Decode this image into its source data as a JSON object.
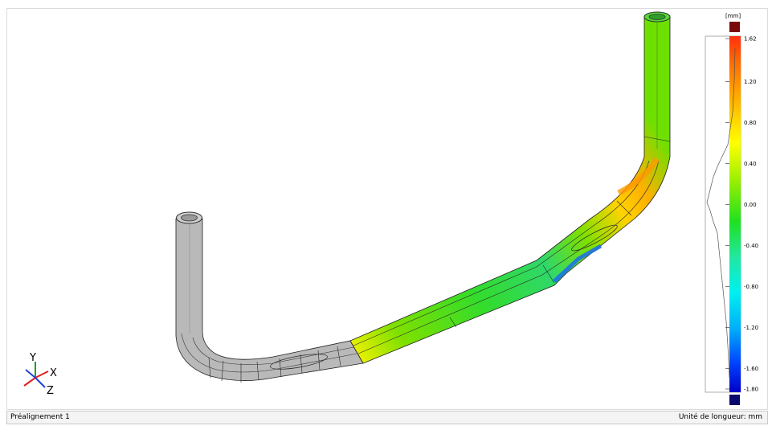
{
  "colors": {
    "hot_end": "#7a0a0a",
    "cold_end": "#0a0a6e",
    "uncolored_surface": "#b8b8b8"
  },
  "viewport": {
    "triad": {
      "x_label": "X",
      "y_label": "Y",
      "z_label": "Z"
    }
  },
  "legend": {
    "unit": "[mm]",
    "ticks": [
      "1.62",
      "1.20",
      "0.80",
      "0.40",
      "0.00",
      "-0.40",
      "-0.80",
      "-1.20",
      "-1.60",
      "-1.80"
    ]
  },
  "status_bar": {
    "left": "Préalignement 1",
    "right": "Unité de longueur: mm"
  }
}
